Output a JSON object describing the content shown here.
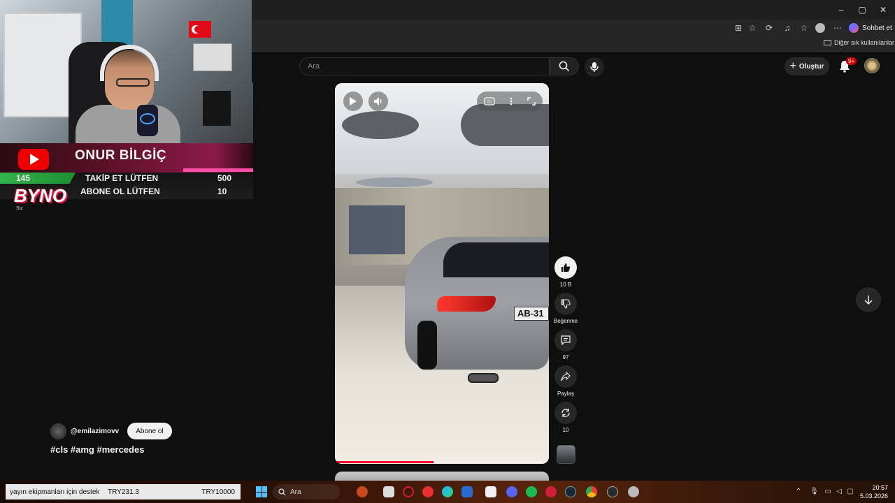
{
  "browser": {
    "window_controls": {
      "minimize": "–",
      "maximize": "▢",
      "close": "✕"
    },
    "copilot_label": "Sohbet et",
    "bookmarks_folder": "Diğer sık kullanılanlar"
  },
  "youtube": {
    "search_placeholder": "Ara",
    "create_label": "Oluştur",
    "notification_badge": "9+"
  },
  "video": {
    "plate_text": "AB-31",
    "progress_fraction": 0.46
  },
  "actions": {
    "like_count": "10 B",
    "dislike_label": "Beğenme",
    "comment_count": "97",
    "share_label": "Paylaş",
    "remix_count": "10"
  },
  "channel": {
    "handle": "@emilazimovv",
    "subscribe_label": "Abone ol",
    "hashtags": "#cls #amg #mercedes"
  },
  "stream_overlay": {
    "streamer_name": "ONUR BİLGİÇ",
    "goal_count": "145",
    "goal1_label": "TAKİP ET LÜTFEN",
    "goal1_target": "500",
    "goal2_label": "ABONE OL LÜTFEN",
    "goal2_target": "10",
    "byno_logo": "BYNO",
    "byno_sub": "Siz"
  },
  "taskbar": {
    "ticker_text": "yayın ekipmanları için destek",
    "ticker_price1": "TRY231.3",
    "ticker_price2": "TRY10000",
    "search_label": "Ara",
    "time": "20:57",
    "date": "5.03.2026"
  },
  "colors": {
    "accent_red": "#ff0033",
    "notification_red": "#cc0000",
    "goal_green": "#33b34a",
    "banner_pink": "#ff4fa8"
  }
}
